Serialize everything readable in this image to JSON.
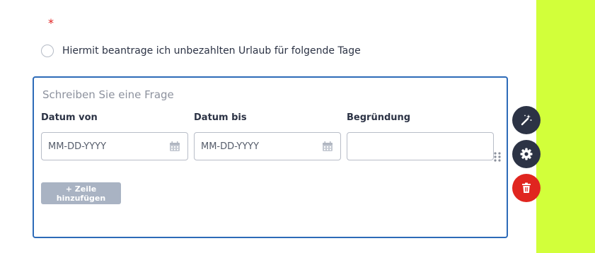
{
  "form": {
    "required_marker": "*",
    "radio_option_label": "Hiermit beantrage ich unbezahlten Urlaub für folgende Tage"
  },
  "question": {
    "placeholder": "Schreiben Sie eine Frage",
    "columns": [
      {
        "label": "Datum von",
        "placeholder": "MM-DD-YYYY",
        "type": "date"
      },
      {
        "label": "Datum bis",
        "placeholder": "MM-DD-YYYY",
        "type": "date"
      },
      {
        "label": "Begründung",
        "placeholder": "",
        "type": "text"
      }
    ],
    "add_row_label": "+ Zeile hinzufügen"
  },
  "toolbar": {
    "icons": [
      "magic-wand-icon",
      "gear-icon",
      "trash-icon"
    ]
  },
  "colors": {
    "page_background": "#d2ff3a",
    "card_border": "#2d6bb8",
    "required": "#e02020",
    "tool_dark": "#2c3345",
    "delete_red": "#e0251f",
    "add_button": "#a9b3c3"
  }
}
